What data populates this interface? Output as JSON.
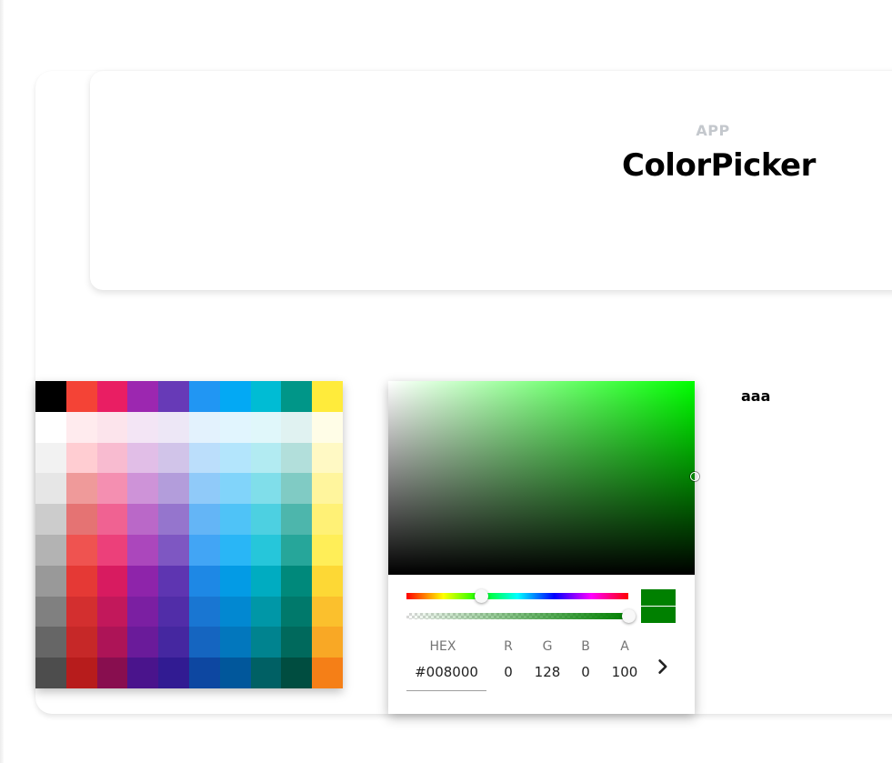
{
  "header": {
    "app_label": "APP",
    "title": "ColorPicker"
  },
  "swatches": [
    [
      "#000000",
      "#f44336",
      "#e91e63",
      "#9c27b0",
      "#673ab7",
      "#2196f3",
      "#03a9f4",
      "#00bcd4",
      "#009688",
      "#ffeb3b"
    ],
    [
      "#ffffff",
      "#ffebee",
      "#fce4ec",
      "#f3e5f5",
      "#ede7f6",
      "#e3f2fd",
      "#e1f5fe",
      "#e0f7fa",
      "#e0f2f1",
      "#fffde7"
    ],
    [
      "#f2f2f2",
      "#ffcdd2",
      "#f8bbd0",
      "#e1bee7",
      "#d1c4e9",
      "#bbdefb",
      "#b3e5fc",
      "#b2ebf2",
      "#b2dfdb",
      "#fff9c4"
    ],
    [
      "#e6e6e6",
      "#ef9a9a",
      "#f48fb1",
      "#ce93d8",
      "#b39ddb",
      "#90caf9",
      "#81d4fa",
      "#80deea",
      "#80cbc4",
      "#fff59d"
    ],
    [
      "#cccccc",
      "#e57373",
      "#f06292",
      "#ba68c8",
      "#9575cd",
      "#64b5f6",
      "#4fc3f7",
      "#4dd0e1",
      "#4db6ac",
      "#fff176"
    ],
    [
      "#b3b3b3",
      "#ef5350",
      "#ec407a",
      "#ab47bc",
      "#7e57c2",
      "#42a5f5",
      "#29b6f6",
      "#26c6da",
      "#26a69a",
      "#ffee58"
    ],
    [
      "#999999",
      "#e53935",
      "#d81b60",
      "#8e24aa",
      "#5e35b1",
      "#1e88e5",
      "#039be5",
      "#00acc1",
      "#00897b",
      "#fdd835"
    ],
    [
      "#808080",
      "#d32f2f",
      "#c2185b",
      "#7b1fa2",
      "#512da8",
      "#1976d2",
      "#0288d1",
      "#0097a7",
      "#00796b",
      "#fbc02d"
    ],
    [
      "#666666",
      "#c62828",
      "#ad1457",
      "#6a1b9a",
      "#4527a0",
      "#1565c0",
      "#0277bd",
      "#00838f",
      "#00695c",
      "#f9a825"
    ],
    [
      "#4d4d4d",
      "#b71c1c",
      "#880e4f",
      "#4a148c",
      "#311b92",
      "#0d47a1",
      "#01579b",
      "#006064",
      "#004d40",
      "#f57f17"
    ]
  ],
  "picker": {
    "current_color": "#008000",
    "hue_degrees": 120,
    "alpha_fraction": 1.0,
    "fields": {
      "hex": {
        "label": "HEX",
        "value": "#008000"
      },
      "r": {
        "label": "R",
        "value": "0"
      },
      "g": {
        "label": "G",
        "value": "128"
      },
      "b": {
        "label": "B",
        "value": "0"
      },
      "a": {
        "label": "A",
        "value": "100"
      }
    },
    "next_icon": "chevron-right-icon"
  },
  "side_text": "aaa"
}
